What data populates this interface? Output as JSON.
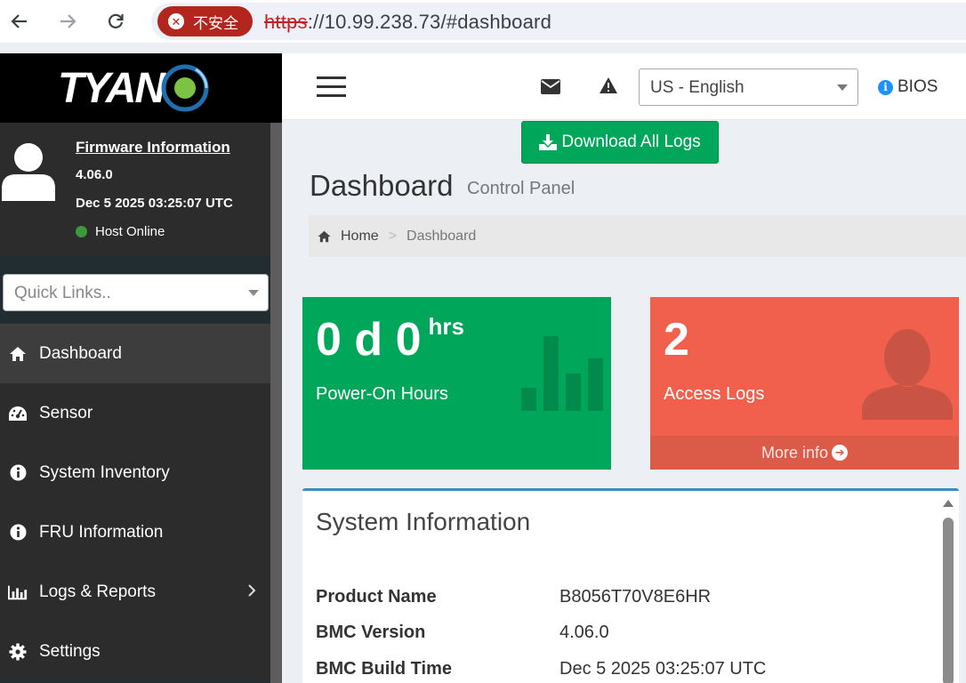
{
  "browser": {
    "security_label": "不安全",
    "url_protocol": "https",
    "url_rest": "://10.99.238.73/#dashboard"
  },
  "sidebar": {
    "logo_text": "TYAN",
    "firmware_link": "Firmware Information",
    "firmware_version": "4.06.0",
    "firmware_date": "Dec 5 2025 03:25:07 UTC",
    "host_status": "Host Online",
    "quick_links_placeholder": "Quick Links..",
    "items": [
      {
        "label": "Dashboard",
        "icon": "home-icon",
        "active": true
      },
      {
        "label": "Sensor",
        "icon": "gauge-icon"
      },
      {
        "label": "System Inventory",
        "icon": "info-circle-icon"
      },
      {
        "label": "FRU Information",
        "icon": "info-circle-icon"
      },
      {
        "label": "Logs & Reports",
        "icon": "bar-chart-icon",
        "has_submenu": true
      },
      {
        "label": "Settings",
        "icon": "gear-icon"
      }
    ]
  },
  "header": {
    "language": "US - English",
    "bios_label": "BIOS"
  },
  "content": {
    "download_button": "Download All Logs",
    "title": "Dashboard",
    "subtitle": "Control Panel",
    "breadcrumb": {
      "home": "Home",
      "current": "Dashboard"
    },
    "tiles": {
      "hours_value": "0 d 0",
      "hours_unit": "hrs",
      "hours_label": "Power-On Hours",
      "logs_value": "2",
      "logs_label": "Access Logs",
      "logs_more": "More info"
    },
    "system_info": {
      "title": "System Information",
      "rows": [
        {
          "key": "Product Name",
          "value": "B8056T70V8E6HR"
        },
        {
          "key": "BMC Version",
          "value": "4.06.0"
        },
        {
          "key": "BMC Build Time",
          "value": "Dec 5 2025 03:25:07 UTC"
        }
      ]
    }
  },
  "colors": {
    "sidebar_bg": "#2c2c2c",
    "success": "#00a65a",
    "danger": "#f0604c",
    "accent": "#3c8dbc",
    "insecure": "#b3261e"
  }
}
